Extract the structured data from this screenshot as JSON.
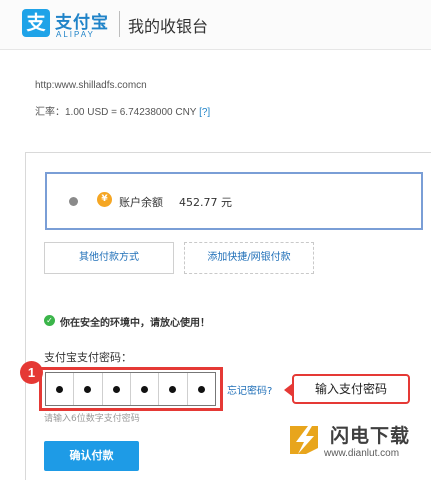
{
  "header": {
    "logo_glyph": "支",
    "logo_cn": "支付宝",
    "logo_en": "ALIPAY",
    "title": "我的收银台"
  },
  "merchant": {
    "url": "http:www.shilladfs.comcn",
    "rate": "汇率：1.00 USD = 6.74238000 CNY",
    "rate_help": "[?]"
  },
  "payment": {
    "balance_icon": "yen-coin-icon",
    "balance_label": "账户余额",
    "balance_amount": "452.77 元",
    "other_methods_label": "其他付款方式",
    "add_card_label": "添加快捷/网银付款"
  },
  "security": {
    "icon": "check-circle-icon",
    "message": "你在安全的环境中，请放心使用！"
  },
  "password": {
    "label": "支付宝支付密码：",
    "digits": 6,
    "forgot_label": "忘记密码?",
    "hint": "请输入6位数字支付密码"
  },
  "annotation": {
    "step_number": "1",
    "callout": "输入支付密码",
    "accent_color": "#e53935"
  },
  "confirm_label": "确认付款",
  "watermark": {
    "title": "闪电下载",
    "url": "www.dianlut.com"
  },
  "colors": {
    "brand": "#1f83c8",
    "button": "#1e9be6",
    "safe": "#3bb54a"
  }
}
